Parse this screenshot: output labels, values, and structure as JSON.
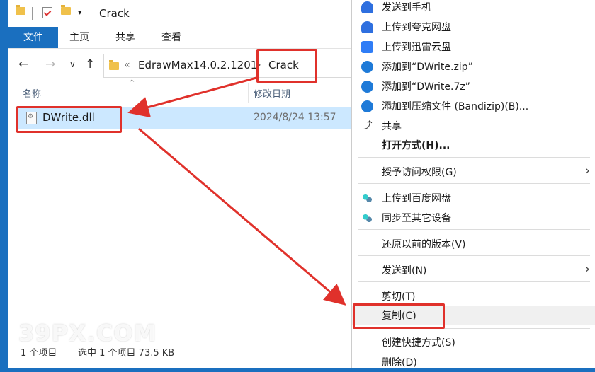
{
  "window": {
    "title": "Crack"
  },
  "ribbon": {
    "tabs": [
      "文件",
      "主页",
      "共享",
      "查看"
    ]
  },
  "address": {
    "overflow": "«",
    "crumbs": [
      "EdrawMax14.0.2.1201",
      "Crack"
    ],
    "sep": "›"
  },
  "columns": {
    "name": "名称",
    "date": "修改日期"
  },
  "file": {
    "name": "DWrite.dll",
    "date": "2024/8/24 13:57"
  },
  "status": {
    "count": "1 个项目",
    "selected": "选中 1 个项目  73.5 KB"
  },
  "watermark": "39PX.COM",
  "menu": {
    "items": [
      {
        "label": "发送到手机",
        "icon": "cloud-icon"
      },
      {
        "label": "上传到夸克网盘",
        "icon": "cloud-icon"
      },
      {
        "label": "上传到迅雷云盘",
        "icon": "bird-icon"
      },
      {
        "label": "添加到“DWrite.zip”",
        "icon": "bandizip-icon"
      },
      {
        "label": "添加到“DWrite.7z”",
        "icon": "bandizip-icon"
      },
      {
        "label": "添加到压缩文件 (Bandizip)(B)...",
        "icon": "bandizip-icon"
      },
      {
        "label": "共享",
        "icon": "share-icon"
      },
      {
        "label": "打开方式(H)...",
        "icon": ""
      },
      {
        "label": "授予访问权限(G)",
        "icon": "",
        "submenu": true
      },
      {
        "label": "上传到百度网盘",
        "icon": "baidu-icon"
      },
      {
        "label": "同步至其它设备",
        "icon": "baidu-icon"
      },
      {
        "label": "还原以前的版本(V)",
        "icon": ""
      },
      {
        "label": "发送到(N)",
        "icon": "",
        "submenu": true
      },
      {
        "label": "剪切(T)",
        "icon": ""
      },
      {
        "label": "复制(C)",
        "icon": ""
      },
      {
        "label": "创建快捷方式(S)",
        "icon": ""
      },
      {
        "label": "删除(D)",
        "icon": ""
      }
    ],
    "submenu_arrow": "›"
  },
  "colors": {
    "accent": "#1a6fbf",
    "selection": "#cce8ff",
    "annotation": "#e0312b"
  }
}
